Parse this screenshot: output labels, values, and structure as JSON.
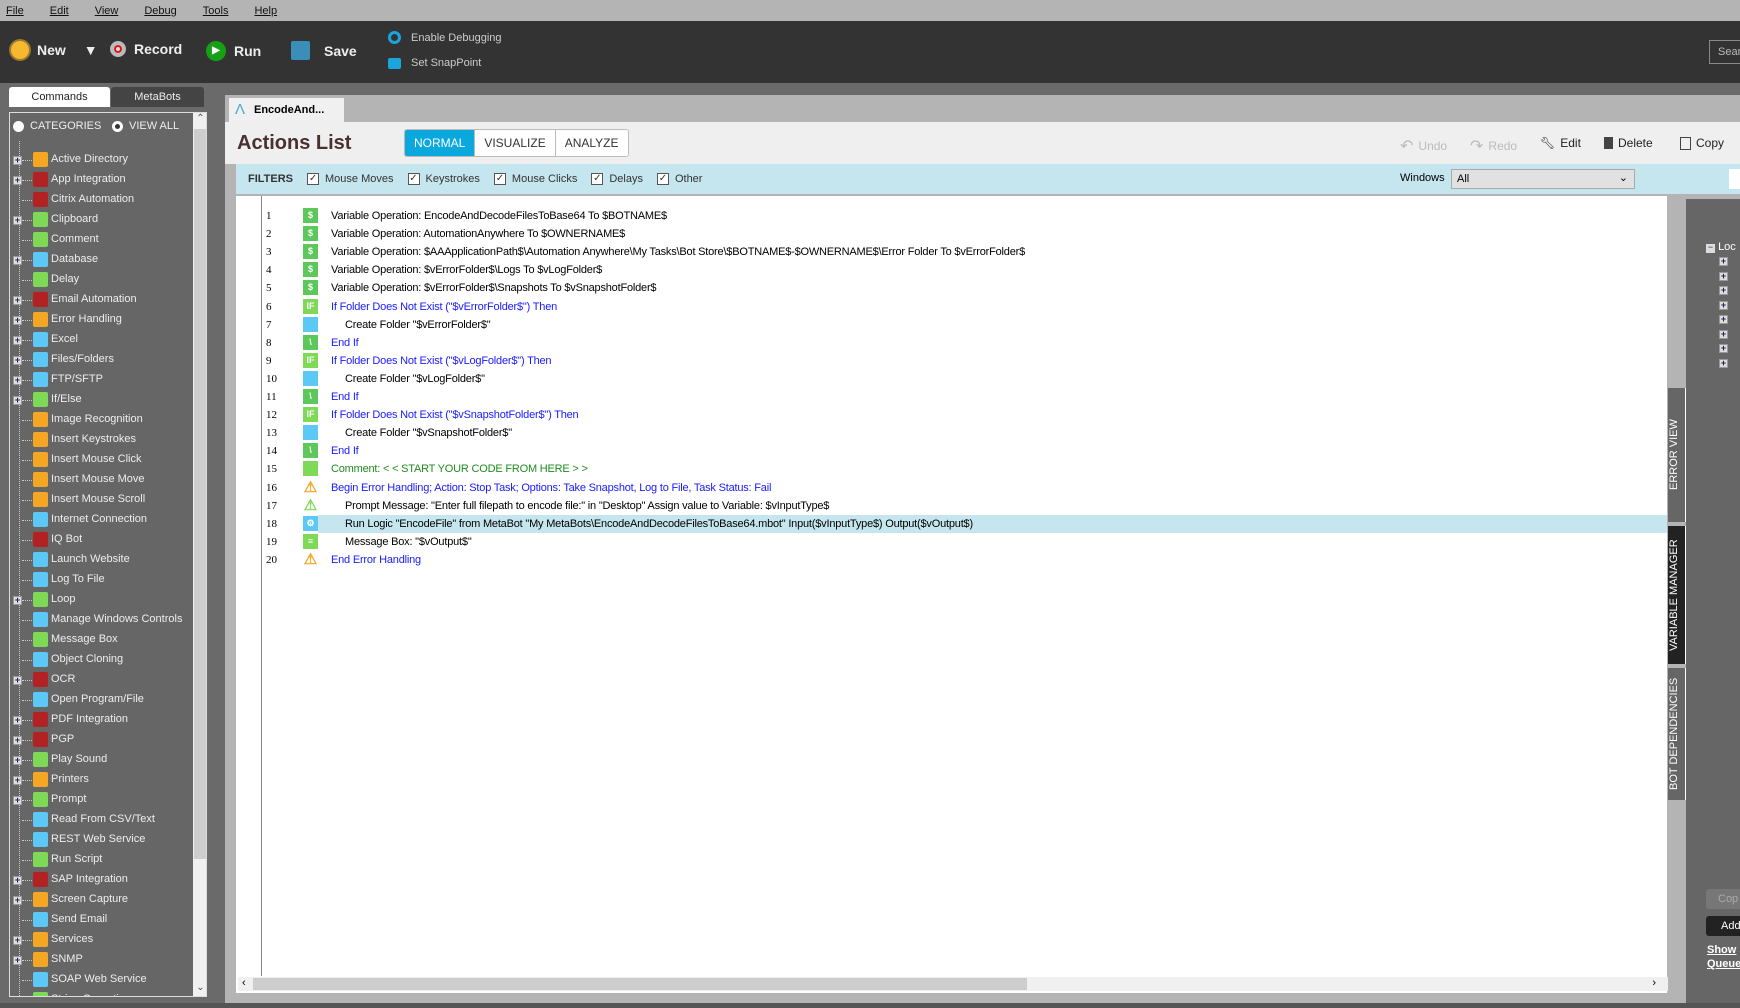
{
  "menu": [
    "File",
    "Edit",
    "View",
    "Debug",
    "Tools",
    "Help"
  ],
  "toolbar": {
    "new": "New",
    "record": "Record",
    "run": "Run",
    "save": "Save",
    "enable_debugging": "Enable Debugging",
    "set_snappoint": "Set SnapPoint",
    "search": "Sear"
  },
  "left": {
    "tabs": [
      "Commands",
      "MetaBots"
    ],
    "radio_categories": "CATEGORIES",
    "radio_view_all": "VIEW ALL",
    "items": [
      {
        "label": "Active Directory",
        "exp": true,
        "color": "#f5a623",
        "icon": "active-directory"
      },
      {
        "label": "App Integration",
        "exp": true,
        "color": "#b22222",
        "icon": "app-integration"
      },
      {
        "label": "Citrix Automation",
        "exp": false,
        "color": "#b22222",
        "icon": "citrix"
      },
      {
        "label": "Clipboard",
        "exp": true,
        "color": "#7ed957",
        "icon": "clipboard"
      },
      {
        "label": "Comment",
        "exp": false,
        "color": "#7ed957",
        "icon": "comment"
      },
      {
        "label": "Database",
        "exp": true,
        "color": "#5bc8f5",
        "icon": "database"
      },
      {
        "label": "Delay",
        "exp": false,
        "color": "#7ed957",
        "icon": "hourglass"
      },
      {
        "label": "Email Automation",
        "exp": true,
        "color": "#b22222",
        "icon": "email"
      },
      {
        "label": "Error Handling",
        "exp": true,
        "color": "#f5a623",
        "icon": "warning"
      },
      {
        "label": "Excel",
        "exp": true,
        "color": "#5bc8f5",
        "icon": "excel"
      },
      {
        "label": "Files/Folders",
        "exp": true,
        "color": "#5bc8f5",
        "icon": "folder"
      },
      {
        "label": "FTP/SFTP",
        "exp": true,
        "color": "#5bc8f5",
        "icon": "ftp"
      },
      {
        "label": "If/Else",
        "exp": true,
        "color": "#7ed957",
        "icon": "if"
      },
      {
        "label": "Image Recognition",
        "exp": false,
        "color": "#f5a623",
        "icon": "image"
      },
      {
        "label": "Insert Keystrokes",
        "exp": false,
        "color": "#f5a623",
        "icon": "keystroke"
      },
      {
        "label": "Insert Mouse Click",
        "exp": false,
        "color": "#f5a623",
        "icon": "mouse"
      },
      {
        "label": "Insert Mouse Move",
        "exp": false,
        "color": "#f5a623",
        "icon": "mouse-move"
      },
      {
        "label": "Insert Mouse Scroll",
        "exp": false,
        "color": "#f5a623",
        "icon": "mouse-scroll"
      },
      {
        "label": "Internet Connection",
        "exp": false,
        "color": "#5bc8f5",
        "icon": "globe"
      },
      {
        "label": "IQ Bot",
        "exp": false,
        "color": "#b22222",
        "icon": "iq-bot"
      },
      {
        "label": "Launch Website",
        "exp": false,
        "color": "#5bc8f5",
        "icon": "website"
      },
      {
        "label": "Log To File",
        "exp": false,
        "color": "#5bc8f5",
        "icon": "log"
      },
      {
        "label": "Loop",
        "exp": true,
        "color": "#7ed957",
        "icon": "loop"
      },
      {
        "label": "Manage Windows Controls",
        "exp": false,
        "color": "#5bc8f5",
        "icon": "windows-controls"
      },
      {
        "label": "Message Box",
        "exp": false,
        "color": "#7ed957",
        "icon": "message"
      },
      {
        "label": "Object Cloning",
        "exp": false,
        "color": "#5bc8f5",
        "icon": "cloning"
      },
      {
        "label": "OCR",
        "exp": true,
        "color": "#b22222",
        "icon": "ocr"
      },
      {
        "label": "Open Program/File",
        "exp": false,
        "color": "#5bc8f5",
        "icon": "open-folder"
      },
      {
        "label": "PDF Integration",
        "exp": true,
        "color": "#b22222",
        "icon": "pdf"
      },
      {
        "label": "PGP",
        "exp": true,
        "color": "#b22222",
        "icon": "key"
      },
      {
        "label": "Play Sound",
        "exp": true,
        "color": "#7ed957",
        "icon": "speaker"
      },
      {
        "label": "Printers",
        "exp": true,
        "color": "#f5a623",
        "icon": "printer"
      },
      {
        "label": "Prompt",
        "exp": true,
        "color": "#7ed957",
        "icon": "prompt"
      },
      {
        "label": "Read From CSV/Text",
        "exp": false,
        "color": "#5bc8f5",
        "icon": "table"
      },
      {
        "label": "REST Web Service",
        "exp": false,
        "color": "#5bc8f5",
        "icon": "monitor"
      },
      {
        "label": "Run Script",
        "exp": false,
        "color": "#7ed957",
        "icon": "script"
      },
      {
        "label": "SAP Integration",
        "exp": true,
        "color": "#b22222",
        "icon": "sap"
      },
      {
        "label": "Screen Capture",
        "exp": true,
        "color": "#f5a623",
        "icon": "camera"
      },
      {
        "label": "Send Email",
        "exp": false,
        "color": "#5bc8f5",
        "icon": "envelope"
      },
      {
        "label": "Services",
        "exp": true,
        "color": "#f5a623",
        "icon": "services"
      },
      {
        "label": "SNMP",
        "exp": true,
        "color": "#f5a623",
        "icon": "snmp"
      },
      {
        "label": "SOAP Web Service",
        "exp": false,
        "color": "#5bc8f5",
        "icon": "monitor"
      },
      {
        "label": "String Operation",
        "exp": true,
        "color": "#7ed957",
        "icon": "string"
      }
    ]
  },
  "editor": {
    "file_tab": "EncodeAnd...",
    "title": "Actions List",
    "modes": [
      "NORMAL",
      "VISUALIZE",
      "ANALYZE"
    ],
    "active_mode": "NORMAL",
    "actions": {
      "undo": "Undo",
      "redo": "Redo",
      "edit": "Edit",
      "delete": "Delete",
      "copy": "Copy"
    },
    "filters": {
      "label": "FILTERS",
      "items": [
        "Mouse Moves",
        "Keystrokes",
        "Mouse Clicks",
        "Delays",
        "Other"
      ],
      "windows_label": "Windows",
      "windows_value": "All"
    },
    "rows": [
      {
        "n": "1",
        "icon": "variable",
        "text": "Variable Operation: EncodeAndDecodeFilesToBase64 To $BOTNAME$",
        "indent": 0,
        "color": "#000"
      },
      {
        "n": "2",
        "icon": "variable",
        "text": "Variable Operation: AutomationAnywhere To $OWNERNAME$",
        "indent": 0,
        "color": "#000"
      },
      {
        "n": "3",
        "icon": "variable",
        "text": "Variable Operation: $AAApplicationPath$\\Automation Anywhere\\My Tasks\\Bot Store\\$BOTNAME$-$OWNERNAME$\\Error Folder To $vErrorFolder$",
        "indent": 0,
        "color": "#000"
      },
      {
        "n": "4",
        "icon": "variable",
        "text": "Variable Operation: $vErrorFolder$\\Logs To $vLogFolder$",
        "indent": 0,
        "color": "#000"
      },
      {
        "n": "5",
        "icon": "variable",
        "text": "Variable Operation: $vErrorFolder$\\Snapshots To $vSnapshotFolder$",
        "indent": 0,
        "color": "#000"
      },
      {
        "n": "6",
        "icon": "if",
        "text": "If Folder Does Not Exist (\"$vErrorFolder$\")  Then",
        "indent": 0,
        "color": "#1a1aff"
      },
      {
        "n": "7",
        "icon": "folder",
        "text": "Create Folder \"$vErrorFolder$\"",
        "indent": 1,
        "color": "#000"
      },
      {
        "n": "8",
        "icon": "end-if",
        "text": "End If",
        "indent": 0,
        "color": "#1a1aff"
      },
      {
        "n": "9",
        "icon": "if",
        "text": "If Folder Does Not Exist (\"$vLogFolder$\")  Then",
        "indent": 0,
        "color": "#1a1aff"
      },
      {
        "n": "10",
        "icon": "folder",
        "text": "Create Folder \"$vLogFolder$\"",
        "indent": 1,
        "color": "#000"
      },
      {
        "n": "11",
        "icon": "end-if",
        "text": "End If",
        "indent": 0,
        "color": "#1a1aff"
      },
      {
        "n": "12",
        "icon": "if",
        "text": "If Folder Does Not Exist (\"$vSnapshotFolder$\")  Then",
        "indent": 0,
        "color": "#1a1aff"
      },
      {
        "n": "13",
        "icon": "folder",
        "text": "Create Folder \"$vSnapshotFolder$\"",
        "indent": 1,
        "color": "#000"
      },
      {
        "n": "14",
        "icon": "end-if",
        "text": "End If",
        "indent": 0,
        "color": "#1a1aff"
      },
      {
        "n": "15",
        "icon": "comment",
        "text": "Comment: < < START YOUR CODE FROM HERE > >",
        "indent": 0,
        "color": "#1e8c1e"
      },
      {
        "n": "16",
        "icon": "error-handling",
        "text": "Begin Error Handling; Action: Stop Task; Options: Take Snapshot, Log to File,  Task Status: Fail",
        "indent": 0,
        "color": "#1a1aff"
      },
      {
        "n": "17",
        "icon": "prompt",
        "text": "Prompt Message: \"Enter full filepath to encode file:\" in \"Desktop\" Assign value to Variable: $vInputType$",
        "indent": 1,
        "color": "#000"
      },
      {
        "n": "18",
        "icon": "metabot",
        "text": "Run Logic \"EncodeFile\" from MetaBot \"My MetaBots\\EncodeAndDecodeFilesToBase64.mbot\" Input($vInputType$) Output($vOutput$)",
        "indent": 1,
        "color": "#000",
        "selected": true
      },
      {
        "n": "19",
        "icon": "message-box",
        "text": "Message Box: \"$vOutput$\"",
        "indent": 1,
        "color": "#000"
      },
      {
        "n": "20",
        "icon": "error-handling",
        "text": "End Error Handling",
        "indent": 0,
        "color": "#1a1aff"
      }
    ]
  },
  "right": {
    "tabs": [
      "ERROR VIEW",
      "VARIABLE MANAGER",
      "BOT DEPENDENCIES"
    ],
    "tree_root": "Loc",
    "copy_btn": "Cop",
    "add_btn": "Add",
    "show_link": "Show",
    "queue_link": "Queue"
  },
  "colors": {
    "accent": "#0aa8dc",
    "filter_bar": "#c5e5ef",
    "toolbar": "#333333",
    "selected_row": "#c6e6ef"
  }
}
